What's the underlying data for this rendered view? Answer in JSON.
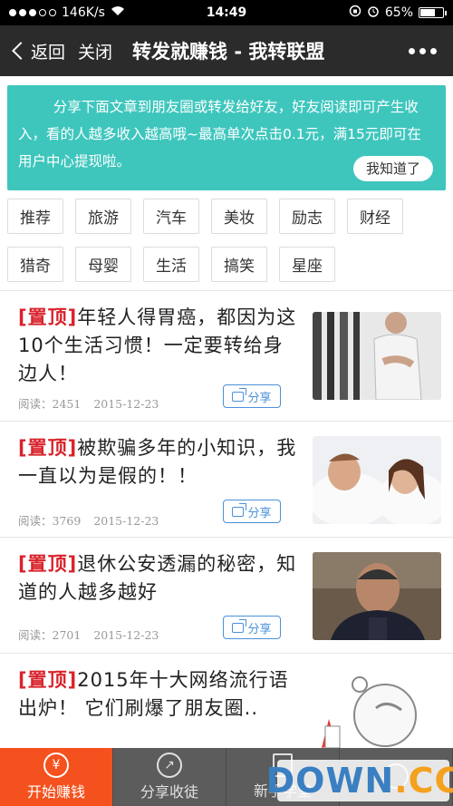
{
  "status_bar": {
    "carrier": "146K/s",
    "time": "14:49",
    "battery": "65%",
    "battery_level": 0.65
  },
  "nav": {
    "back_label": "返回",
    "close_label": "关闭",
    "title": "转发就赚钱 - 我转联盟"
  },
  "notice": {
    "text": "分享下面文章到朋友圈或转发给好友，好友阅读即可产生收入，看的人越多收入越高哦~最高单次点击0.1元，满15元即可在用户中心提现啦。",
    "button": "我知道了"
  },
  "categories": [
    "推荐",
    "旅游",
    "汽车",
    "美妆",
    "励志",
    "财经",
    "猎奇",
    "母婴",
    "生活",
    "搞笑",
    "星座"
  ],
  "articles": [
    {
      "tag": "[置顶]",
      "title": "年轻人得胃癌，都因为这10个生活习惯！一定要转给身边人！",
      "reads_label": "阅读：2451",
      "date": "2015-12-23",
      "share": "分享"
    },
    {
      "tag": "[置顶]",
      "title": "被欺骗多年的小知识，我一直以为是假的！！",
      "reads_label": "阅读：3769",
      "date": "2015-12-23",
      "share": "分享"
    },
    {
      "tag": "[置顶]",
      "title": "退休公安透漏的秘密，知道的人越多越好",
      "reads_label": "阅读：2701",
      "date": "2015-12-23",
      "share": "分享"
    },
    {
      "tag": "[置顶]",
      "title": "2015年十大网络流行语出炉！ 它们刷爆了朋友圈..",
      "reads_label": "",
      "date": "",
      "share": ""
    }
  ],
  "tabs": [
    {
      "label": "开始赚钱",
      "icon": "yen-icon"
    },
    {
      "label": "分享收徒",
      "icon": "share-arrow-icon"
    },
    {
      "label": "新手学堂",
      "icon": "book-icon"
    },
    {
      "label": "",
      "icon": "user-icon"
    }
  ],
  "watermark": {
    "main": "DOWN",
    "suffix": ".CC"
  },
  "colors": {
    "nav": "#2b2b2b",
    "notice": "#3ec6bd",
    "accent": "#f4511e",
    "tag": "#d9232c",
    "share": "#4a90d9"
  }
}
